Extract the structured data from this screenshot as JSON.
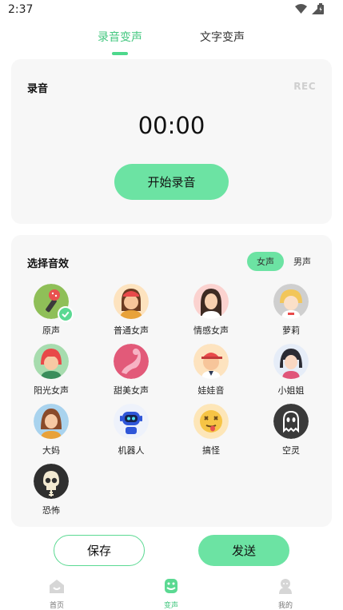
{
  "status_bar": {
    "time": "2:37"
  },
  "top_tabs": [
    {
      "label": "录音变声",
      "active": true
    },
    {
      "label": "文字变声",
      "active": false
    }
  ],
  "record_card": {
    "title": "录音",
    "tag": "REC",
    "timer": "00:00",
    "start_button": "开始录音"
  },
  "effects_card": {
    "title": "选择音效",
    "gender_options": [
      {
        "label": "女声",
        "active": true
      },
      {
        "label": "男声",
        "active": false
      }
    ],
    "effects": [
      {
        "label": "原声",
        "icon": "microphone-avatar-icon",
        "selected": true
      },
      {
        "label": "普通女声",
        "icon": "woman-avatar-icon"
      },
      {
        "label": "情感女声",
        "icon": "woman-avatar-icon"
      },
      {
        "label": "萝莉",
        "icon": "girl-avatar-icon"
      },
      {
        "label": "阳光女声",
        "icon": "woman-avatar-icon"
      },
      {
        "label": "甜美女声",
        "icon": "silhouette-avatar-icon"
      },
      {
        "label": "娃娃音",
        "icon": "child-avatar-icon"
      },
      {
        "label": "小姐姐",
        "icon": "girl-avatar-icon"
      },
      {
        "label": "大妈",
        "icon": "woman-avatar-icon"
      },
      {
        "label": "机器人",
        "icon": "robot-avatar-icon"
      },
      {
        "label": "搞怪",
        "icon": "silly-face-avatar-icon"
      },
      {
        "label": "空灵",
        "icon": "ghost-avatar-icon"
      },
      {
        "label": "恐怖",
        "icon": "skull-avatar-icon"
      }
    ]
  },
  "actions": {
    "save": "保存",
    "send": "发送"
  },
  "bottom_nav": [
    {
      "label": "首页",
      "icon": "home-icon",
      "active": false
    },
    {
      "label": "变声",
      "icon": "voice-change-icon",
      "active": true
    },
    {
      "label": "我的",
      "icon": "profile-icon",
      "active": false
    }
  ],
  "colors": {
    "accent": "#6ce3a3",
    "accent_text": "#43c77f",
    "card_bg": "#f7f7f7"
  }
}
